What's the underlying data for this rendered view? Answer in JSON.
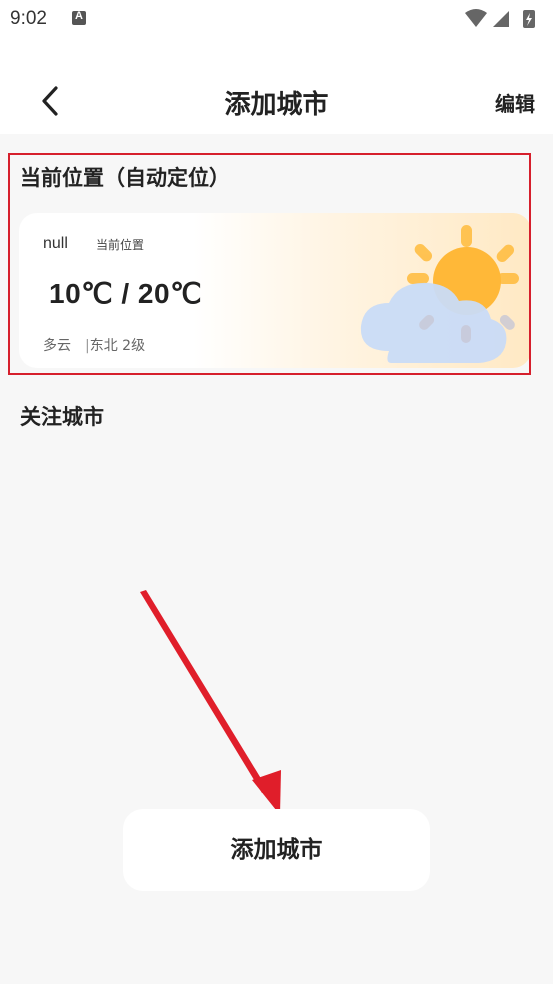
{
  "status_bar": {
    "time": "9:02",
    "icons": [
      "text-notification-icon",
      "wifi-icon",
      "signal-icon",
      "battery-charging-icon"
    ]
  },
  "header": {
    "back_icon": "chevron-left-icon",
    "title": "添加城市",
    "edit_label": "编辑"
  },
  "current_location": {
    "section_title": "当前位置（自动定位）",
    "card": {
      "city": "null",
      "tag": "当前位置",
      "temperature_range": "10℃ / 20℃",
      "condition": "多云",
      "separator": "|",
      "wind": "东北 2级",
      "icon": "partly-cloudy-icon"
    }
  },
  "followed": {
    "section_title": "关注城市"
  },
  "add_button": {
    "label": "添加城市"
  },
  "colors": {
    "highlight_border": "#d61f2c",
    "annotation_arrow": "#e01e2a",
    "sun": "#ffbb3b",
    "cloud": "#c9dbf7",
    "page_background": "#f7f7f7"
  }
}
